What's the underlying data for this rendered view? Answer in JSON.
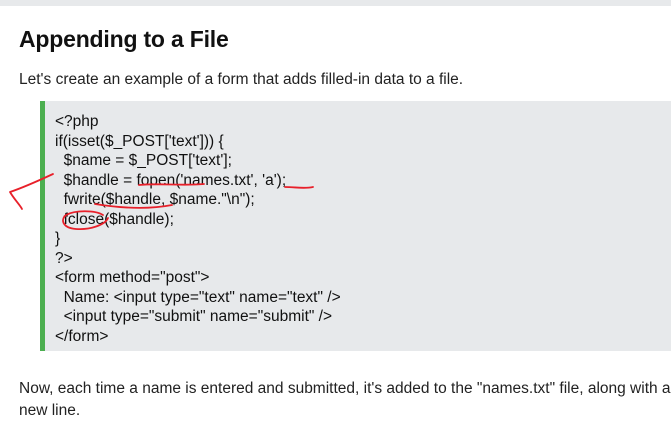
{
  "heading": "Appending to a File",
  "intro": "Let's create an example of a form that adds filled-in data to a file.",
  "code_lines": [
    "<?php",
    "if(isset($_POST['text'])) {",
    "  $name = $_POST['text'];",
    "  $handle = fopen('names.txt', 'a');",
    "  fwrite($handle, $name.\"\\n\");",
    "  fclose($handle);",
    "}",
    "?>",
    "<form method=\"post\">",
    "  Name: <input type=\"text\" name=\"text\" />",
    "  <input type=\"submit\" name=\"submit\" />",
    "</form>"
  ],
  "outro_line1": "Now, each time a name is entered and submitted, it's added to the \"names.txt\" file, along with a",
  "outro_line2": "new line.",
  "colors": {
    "code_border": "#4caf50",
    "code_background": "#e7e9eb",
    "annotation_ink": "#e8202a"
  }
}
